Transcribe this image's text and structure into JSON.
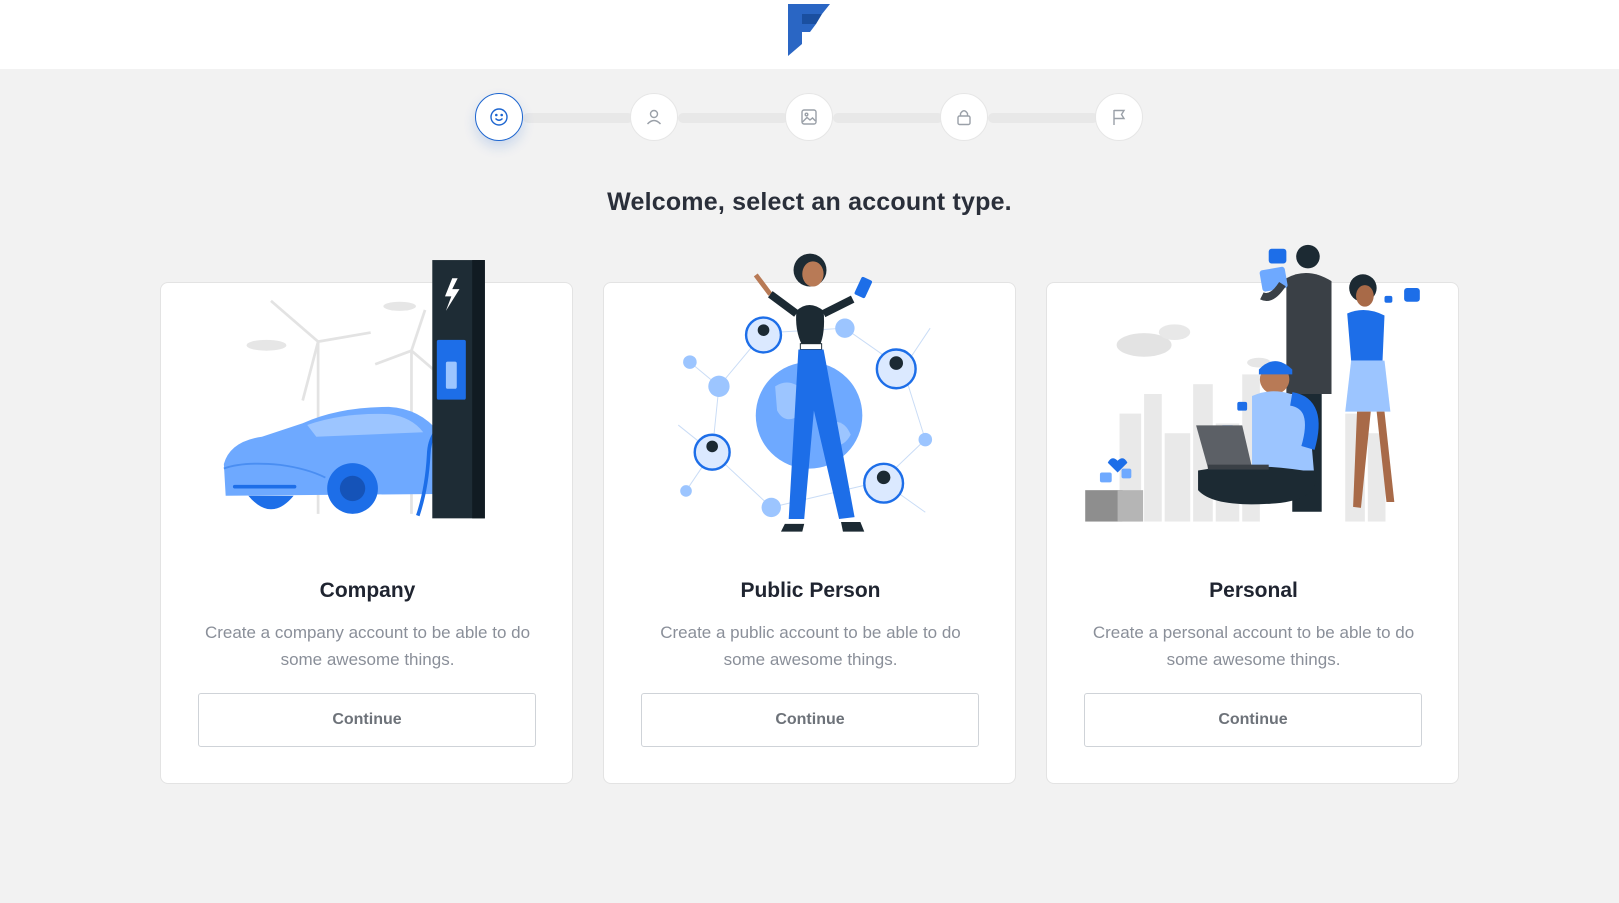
{
  "header": {
    "logo_icon": "brand-f-logo"
  },
  "stepper": {
    "steps": [
      {
        "icon": "smile-icon",
        "active": true
      },
      {
        "icon": "user-icon",
        "active": false
      },
      {
        "icon": "image-icon",
        "active": false
      },
      {
        "icon": "lock-icon",
        "active": false
      },
      {
        "icon": "flag-icon",
        "active": false
      }
    ]
  },
  "main": {
    "heading": "Welcome, select an account type.",
    "cards": [
      {
        "title": "Company",
        "description": "Create a company account to be able to do some awesome things.",
        "button_label": "Continue",
        "illustration": "electric-car-charging"
      },
      {
        "title": "Public Person",
        "description": "Create a public account to be able to do some awesome things.",
        "button_label": "Continue",
        "illustration": "social-network-woman"
      },
      {
        "title": "Personal",
        "description": "Create a personal account to be able to do some awesome things.",
        "button_label": "Continue",
        "illustration": "friends-with-devices"
      }
    ]
  },
  "colors": {
    "accent": "#1e66d0",
    "primary_blue": "#1d6ee8",
    "light_blue": "#67a6ff",
    "dark": "#1c2a33",
    "background": "#f2f2f2"
  }
}
